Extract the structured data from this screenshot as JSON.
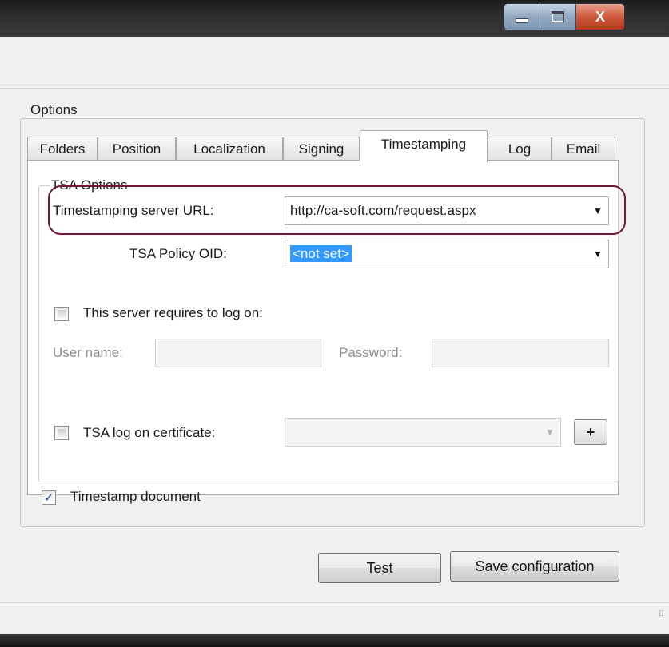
{
  "window": {
    "minimize_icon": "minimize-icon",
    "maximize_icon": "maximize-icon",
    "close_label": "X"
  },
  "options": {
    "group_label": "Options",
    "tabs": [
      {
        "label": "Folders"
      },
      {
        "label": "Position"
      },
      {
        "label": "Localization"
      },
      {
        "label": "Signing"
      },
      {
        "label": "Timestamping",
        "active": true
      },
      {
        "label": "Log"
      },
      {
        "label": "Email"
      }
    ]
  },
  "tsa": {
    "group_label": "TSA Options",
    "server_url_label": "Timestamping server URL:",
    "server_url_value": "http://ca-soft.com/request.aspx",
    "policy_oid_label": "TSA Policy OID:",
    "policy_oid_value": "<not set>",
    "requires_logon_label": "This server requires to log on:",
    "requires_logon_checked": false,
    "user_name_label": "User name:",
    "password_label": "Password:",
    "certificate_label": "TSA log on certificate:",
    "certificate_checked": false,
    "add_certificate_label": "+"
  },
  "timestamp_document": {
    "label": "Timestamp document",
    "checked": true,
    "check_glyph": "✓"
  },
  "buttons": {
    "test_label": "Test",
    "save_label": "Save configuration"
  },
  "colors": {
    "highlight_outline": "#6b1a3a",
    "selection": "#3399ff"
  }
}
